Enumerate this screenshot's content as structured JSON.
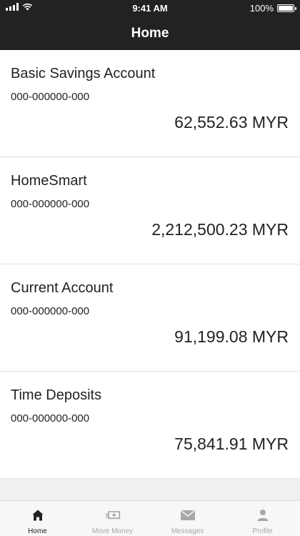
{
  "status_bar": {
    "time": "9:41 AM",
    "battery_label": "100%",
    "battery_level": 1.0
  },
  "header": {
    "title": "Home"
  },
  "accounts": [
    {
      "name": "Basic Savings Account",
      "number": "000-000000-000",
      "balance": "62,552.63 MYR"
    },
    {
      "name": "HomeSmart",
      "number": "000-000000-000",
      "balance": "2,212,500.23 MYR"
    },
    {
      "name": "Current Account",
      "number": "000-000000-000",
      "balance": "91,199.08 MYR"
    },
    {
      "name": "Time Deposits",
      "number": "000-000000-000",
      "balance": "75,841.91 MYR"
    }
  ],
  "tabbar": {
    "items": [
      {
        "label": "Home",
        "icon": "home-icon",
        "active": true
      },
      {
        "label": "Move Money",
        "icon": "money-transfer-icon",
        "active": false
      },
      {
        "label": "Messages",
        "icon": "envelope-icon",
        "active": false
      },
      {
        "label": "Profile",
        "icon": "person-icon",
        "active": false
      }
    ]
  },
  "colors": {
    "header_bg": "#222222",
    "active_tab": "#222222",
    "inactive_tab": "#a8a8a8"
  }
}
